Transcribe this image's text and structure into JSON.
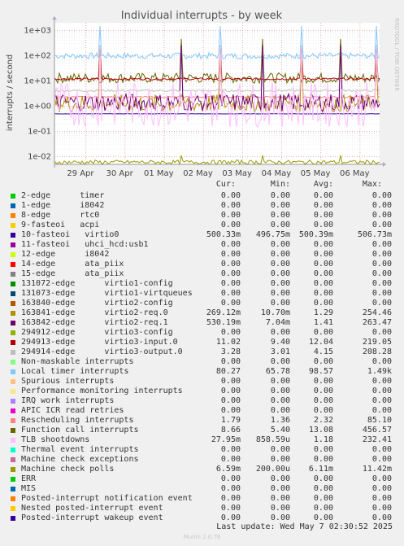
{
  "chart_data": {
    "type": "line",
    "title": "Individual interrupts - by week",
    "ylabel": "interrupts / second",
    "yscale": "log",
    "ylim": [
      0.005,
      2000
    ],
    "yticks": [
      "1e-02",
      "1e-01",
      "1e+00",
      "1e+01",
      "1e+02",
      "1e+03"
    ],
    "xticks": [
      "29 Apr",
      "30 Apr",
      "01 May",
      "02 May",
      "03 May",
      "04 May",
      "05 May",
      "06 May"
    ],
    "side_label": "RRDTOOL / TOBI OETIKER",
    "grid": true,
    "headers": [
      "Cur:",
      "Min:",
      "Avg:",
      "Max:"
    ],
    "series": [
      {
        "name": "2-edge      timer",
        "color": "#00cc00",
        "cur": "0.00",
        "min": "0.00",
        "avg": "0.00",
        "max": "0.00"
      },
      {
        "name": "1-edge      i8042",
        "color": "#0066b3",
        "cur": "0.00",
        "min": "0.00",
        "avg": "0.00",
        "max": "0.00"
      },
      {
        "name": "8-edge      rtc0",
        "color": "#ff8000",
        "cur": "0.00",
        "min": "0.00",
        "avg": "0.00",
        "max": "0.00"
      },
      {
        "name": "9-fasteoi   acpi",
        "color": "#ffcc00",
        "cur": "0.00",
        "min": "0.00",
        "avg": "0.00",
        "max": "0.00"
      },
      {
        "name": "10-fasteoi   virtio0",
        "color": "#330099",
        "cur": "500.33m",
        "min": "496.75m",
        "avg": "500.39m",
        "max": "506.73m"
      },
      {
        "name": "11-fasteoi   uhci_hcd:usb1",
        "color": "#990099",
        "cur": "0.00",
        "min": "0.00",
        "avg": "0.00",
        "max": "0.00"
      },
      {
        "name": "12-edge      i8042",
        "color": "#ccff00",
        "cur": "0.00",
        "min": "0.00",
        "avg": "0.00",
        "max": "0.00"
      },
      {
        "name": "14-edge      ata_piix",
        "color": "#ff0000",
        "cur": "0.00",
        "min": "0.00",
        "avg": "0.00",
        "max": "0.00"
      },
      {
        "name": "15-edge      ata_piix",
        "color": "#808080",
        "cur": "0.00",
        "min": "0.00",
        "avg": "0.00",
        "max": "0.00"
      },
      {
        "name": "131072-edge      virtio1-config",
        "color": "#008f00",
        "cur": "0.00",
        "min": "0.00",
        "avg": "0.00",
        "max": "0.00"
      },
      {
        "name": "131073-edge      virtio1-virtqueues",
        "color": "#00487d",
        "cur": "0.00",
        "min": "0.00",
        "avg": "0.00",
        "max": "0.00"
      },
      {
        "name": "163840-edge      virtio2-config",
        "color": "#b35a00",
        "cur": "0.00",
        "min": "0.00",
        "avg": "0.00",
        "max": "0.00"
      },
      {
        "name": "163841-edge      virtio2-req.0",
        "color": "#b38f00",
        "cur": "269.12m",
        "min": "10.70m",
        "avg": "1.29",
        "max": "254.46"
      },
      {
        "name": "163842-edge      virtio2-req.1",
        "color": "#6b006b",
        "cur": "530.19m",
        "min": "7.04m",
        "avg": "1.41",
        "max": "263.47"
      },
      {
        "name": "294912-edge      virtio3-config",
        "color": "#8fb300",
        "cur": "0.00",
        "min": "0.00",
        "avg": "0.00",
        "max": "0.00"
      },
      {
        "name": "294913-edge      virtio3-input.0",
        "color": "#b30000",
        "cur": "11.02",
        "min": "9.40",
        "avg": "12.04",
        "max": "219.05"
      },
      {
        "name": "294914-edge      virtio3-output.0",
        "color": "#bebebe",
        "cur": "3.28",
        "min": "3.01",
        "avg": "4.15",
        "max": "208.28"
      },
      {
        "name": "Non-maskable interrupts",
        "color": "#80ff80",
        "cur": "0.00",
        "min": "0.00",
        "avg": "0.00",
        "max": "0.00"
      },
      {
        "name": "Local timer interrupts",
        "color": "#80c9ff",
        "cur": "80.27",
        "min": "65.78",
        "avg": "98.57",
        "max": "1.49k"
      },
      {
        "name": "Spurious interrupts",
        "color": "#ffc080",
        "cur": "0.00",
        "min": "0.00",
        "avg": "0.00",
        "max": "0.00"
      },
      {
        "name": "Performance monitoring interrupts",
        "color": "#ffe680",
        "cur": "0.00",
        "min": "0.00",
        "avg": "0.00",
        "max": "0.00"
      },
      {
        "name": "IRQ work interrupts",
        "color": "#aa80ff",
        "cur": "0.00",
        "min": "0.00",
        "avg": "0.00",
        "max": "0.00"
      },
      {
        "name": "APIC ICR read retries",
        "color": "#ee00cc",
        "cur": "0.00",
        "min": "0.00",
        "avg": "0.00",
        "max": "0.00"
      },
      {
        "name": "Rescheduling interrupts",
        "color": "#ff8080",
        "cur": "1.79",
        "min": "1.36",
        "avg": "2.32",
        "max": "85.10"
      },
      {
        "name": "Function call interrupts",
        "color": "#666600",
        "cur": "8.66",
        "min": "5.40",
        "avg": "13.08",
        "max": "456.57"
      },
      {
        "name": "TLB shootdowns",
        "color": "#ffbfff",
        "cur": "27.95m",
        "min": "858.59u",
        "avg": "1.18",
        "max": "232.41"
      },
      {
        "name": "Thermal event interrupts",
        "color": "#00ffcc",
        "cur": "0.00",
        "min": "0.00",
        "avg": "0.00",
        "max": "0.00"
      },
      {
        "name": "Machine check exceptions",
        "color": "#cc6699",
        "cur": "0.00",
        "min": "0.00",
        "avg": "0.00",
        "max": "0.00"
      },
      {
        "name": "Machine check polls",
        "color": "#999900",
        "cur": "6.59m",
        "min": "200.00u",
        "avg": "6.11m",
        "max": "11.42m"
      },
      {
        "name": "ERR",
        "color": "#00cc00",
        "cur": "0.00",
        "min": "0.00",
        "avg": "0.00",
        "max": "0.00"
      },
      {
        "name": "MIS",
        "color": "#0066b3",
        "cur": "0.00",
        "min": "0.00",
        "avg": "0.00",
        "max": "0.00"
      },
      {
        "name": "Posted-interrupt notification event",
        "color": "#ff8000",
        "cur": "0.00",
        "min": "0.00",
        "avg": "0.00",
        "max": "0.00"
      },
      {
        "name": "Nested posted-interrupt event",
        "color": "#ffcc00",
        "cur": "0.00",
        "min": "0.00",
        "avg": "0.00",
        "max": "0.00"
      },
      {
        "name": "Posted-interrupt wakeup event",
        "color": "#330099",
        "cur": "0.00",
        "min": "0.00",
        "avg": "0.00",
        "max": "0.00"
      }
    ],
    "plotted_levels": [
      {
        "color": "#80c9ff",
        "base": 98.57,
        "noise": 0.12,
        "spike": 1490
      },
      {
        "color": "#666600",
        "base": 13.08,
        "noise": 0.2,
        "spike": 456.57
      },
      {
        "color": "#b30000",
        "base": 12.04,
        "noise": 0.04,
        "spike": 219.05
      },
      {
        "color": "#bebebe",
        "base": 4.15,
        "noise": 0.04,
        "spike": 208.28
      },
      {
        "color": "#ff8080",
        "base": 2.32,
        "noise": 0.03,
        "spike": 85.1
      },
      {
        "color": "#330099",
        "base": 0.5,
        "noise": 0.005,
        "spike": 0.5067
      },
      {
        "color": "#b38f00",
        "base": 1.29,
        "noise": 0.35,
        "spike": 254.46
      },
      {
        "color": "#6b006b",
        "base": 1.41,
        "noise": 0.35,
        "spike": 263.47
      },
      {
        "color": "#ffbfff",
        "base": 1.18,
        "noise": 0.9,
        "spike": 232.41
      },
      {
        "color": "#999900",
        "base": 0.00611,
        "noise": 0.08,
        "spike": 0.01142
      }
    ],
    "last_update": "Last update: Wed May  7 02:30:52 2025",
    "generator": "Munin 2.0.76"
  }
}
